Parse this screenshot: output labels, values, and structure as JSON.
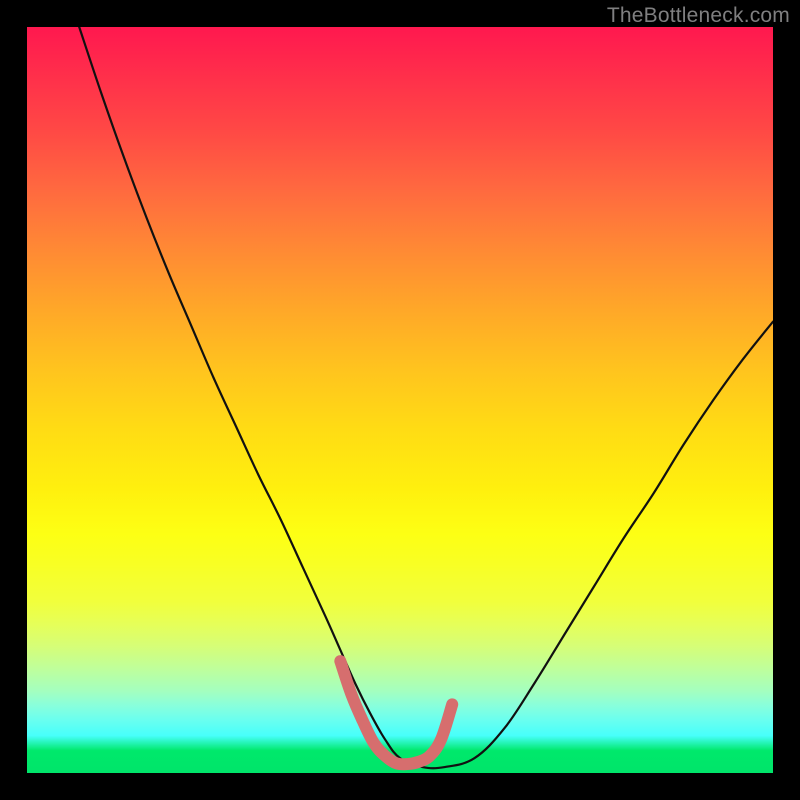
{
  "watermark": "TheBottleneck.com",
  "colors": {
    "background": "#000000",
    "curve_stroke": "#111111",
    "highlight_stroke": "#d66e6e",
    "gradient_top": "#ff184f",
    "gradient_bottom": "#00e46a"
  },
  "chart_data": {
    "type": "line",
    "title": "",
    "xlabel": "",
    "ylabel": "",
    "xlim": [
      0,
      100
    ],
    "ylim": [
      0,
      100
    ],
    "grid": false,
    "legend": false,
    "x": [
      7,
      10,
      13,
      16,
      19,
      22,
      25,
      28,
      31,
      34,
      37,
      40,
      42,
      44,
      46,
      48,
      50,
      53,
      56,
      60,
      64,
      68,
      72,
      76,
      80,
      84,
      88,
      92,
      96,
      100
    ],
    "series": [
      {
        "name": "bottleneck-curve",
        "values": [
          100,
          91,
          82.5,
          74.5,
          67,
          60,
          53,
          46.5,
          40,
          34,
          27.5,
          21,
          16.5,
          12,
          8,
          4.5,
          2,
          0.8,
          0.8,
          2,
          6,
          12,
          18.5,
          25,
          31.5,
          37.5,
          44,
          50,
          55.5,
          60.5
        ]
      }
    ],
    "annotations": [
      {
        "name": "bottom-highlight",
        "type": "line-segment",
        "x": [
          42,
          43.5,
          45,
          46.5,
          48,
          49.5,
          51,
          52.5,
          54,
          55.5,
          57
        ],
        "values": [
          15,
          10.5,
          7,
          4,
          2.3,
          1.3,
          1.2,
          1.5,
          2.3,
          4.5,
          9.2
        ],
        "stroke": "#d66e6e",
        "width": 12
      }
    ]
  }
}
